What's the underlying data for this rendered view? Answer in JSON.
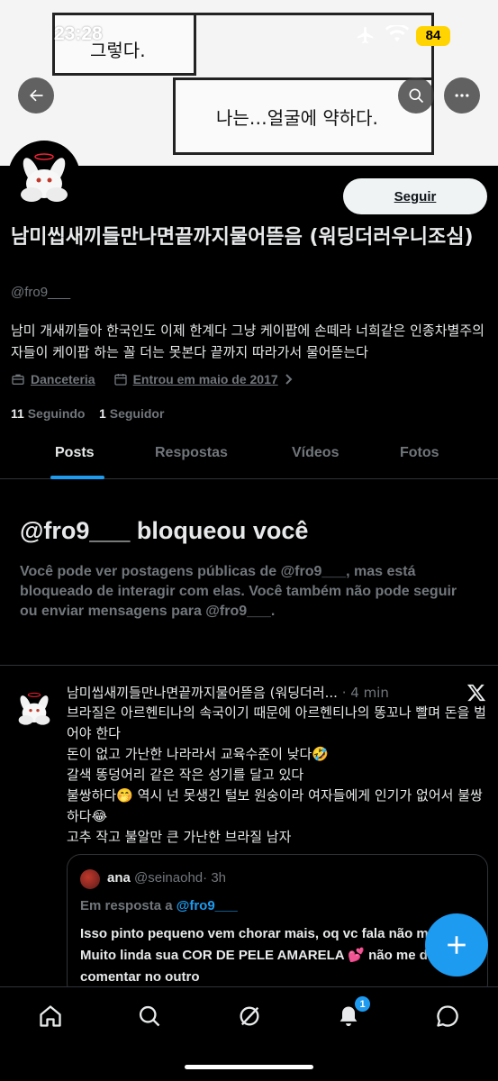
{
  "status_bar": {
    "time": "23:28",
    "battery": "84"
  },
  "banner": {
    "comic_text_1": "그렇다.",
    "comic_text_2": "나는…얼굴에 약하다."
  },
  "profile": {
    "follow_label": "Seguir",
    "display_name": "남미씹새끼들만나면끝까지물어뜯음 (워딩더러우니조심)",
    "handle": "@fro9___",
    "bio": "남미 개새끼들아 한국인도 이제 한계다 그냥 케이팝에 손떼라 너희같은 인종차별주의자들이 케이팝 하는 꼴 더는 못본다 끝까지 따라가서 물어뜯는다",
    "category": "Danceteria",
    "joined": "Entrou em maio de 2017",
    "following_count": "11",
    "following_label": "Seguindo",
    "followers_count": "1",
    "followers_label": "Seguidor"
  },
  "tabs": [
    "Posts",
    "Respostas",
    "Vídeos",
    "Fotos"
  ],
  "blocked": {
    "title": "@fro9___ bloqueou você",
    "text": "Você pode ver postagens públicas de @fro9___, mas está bloqueado de interagir com elas. Você também não pode seguir ou enviar mensagens para @fro9___."
  },
  "tweet": {
    "author": "남미씹새끼들만나면끝까지물어뜯음 (워딩더러...",
    "time": "· 4 min",
    "lines": [
      "브라질은 아르헨티나의 속국이기 때문에 아르헨티나의 똥꼬나 빨며 돈을 벌어야 한다",
      "돈이 없고 가난한 나라라서 교육수준이 낮다🤣",
      "갈색 똥덩어리 같은 작은 성기를 달고 있다",
      "불쌍하다🤭 역시 넌 못생긴 털보 원숭이라 여자들에게 인기가 없어서 불쌍하다😂",
      "고추 작고 불알만 큰 가난한 브라질 남자"
    ],
    "quote": {
      "name": "ana",
      "handle": "@seinaohd",
      "time": "· 3h",
      "reply_prefix": "Em resposta a",
      "reply_mention": "@fro9___",
      "text": "Isso pinto pequeno vem chorar mais, oq vc fala não me afeta. Muito linda sua COR DE PELE AMARELA 💕 não me deixou comentar no outro"
    }
  },
  "bottom_nav": {
    "notification_count": "1"
  },
  "colors": {
    "accent": "#1d9bf0",
    "background": "#000000",
    "secondary_text": "#71767b"
  }
}
